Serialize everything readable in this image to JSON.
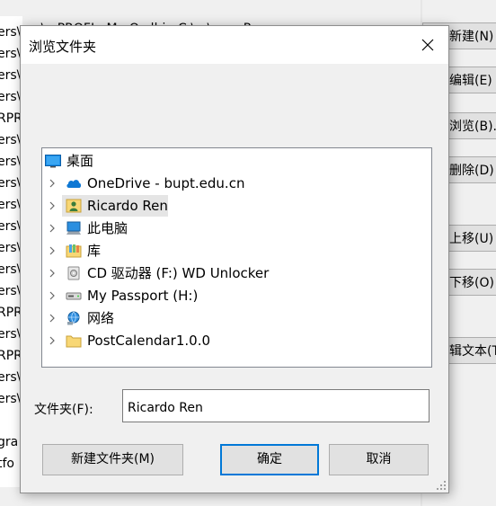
{
  "background": {
    "top_text": "ers\\...PROFI...M...O...lbin;C:\\...\\...n...P...",
    "left_lines": [
      "ers\\",
      "ers\\",
      "ers\\",
      "ers\\",
      "RPR",
      "ers\\",
      "ers\\",
      "ers\\",
      "ers\\",
      "ers\\",
      "ers\\",
      "ers\\",
      "ers\\",
      "RPR",
      "ers\\",
      "RPR",
      "ers\\",
      "ers\\",
      "gra",
      "tfo"
    ],
    "buttons": {
      "new": "新建(N)",
      "edit": "编辑(E)",
      "browse": "浏览(B)...",
      "delete": "删除(D)",
      "move_up": "上移(U)",
      "move_down": "下移(O)",
      "edit_text": "辑文本(T)"
    }
  },
  "dialog": {
    "title": "浏览文件夹",
    "tree": [
      {
        "label": "桌面",
        "icon": "desktop-icon"
      },
      {
        "label": "OneDrive - bupt.edu.cn",
        "icon": "onedrive-cloud-icon"
      },
      {
        "label": "Ricardo Ren",
        "icon": "user-folder-icon"
      },
      {
        "label": "此电脑",
        "icon": "this-pc-icon"
      },
      {
        "label": "库",
        "icon": "library-icon"
      },
      {
        "label": "CD 驱动器 (F:) WD Unlocker",
        "icon": "cd-drive-icon"
      },
      {
        "label": "My Passport (H:)",
        "icon": "external-drive-icon"
      },
      {
        "label": "网络",
        "icon": "network-icon"
      },
      {
        "label": "PostCalendar1.0.0",
        "icon": "folder-icon"
      }
    ],
    "folder_label": "文件夹(F):",
    "folder_value": "Ricardo Ren",
    "buttons": {
      "new_folder": "新建文件夹(M)",
      "ok": "确定",
      "cancel": "取消"
    }
  },
  "colors": {
    "accent": "#0078d7",
    "selected_row": "#e5e5e5",
    "folder_yellow": "#f8d775"
  }
}
